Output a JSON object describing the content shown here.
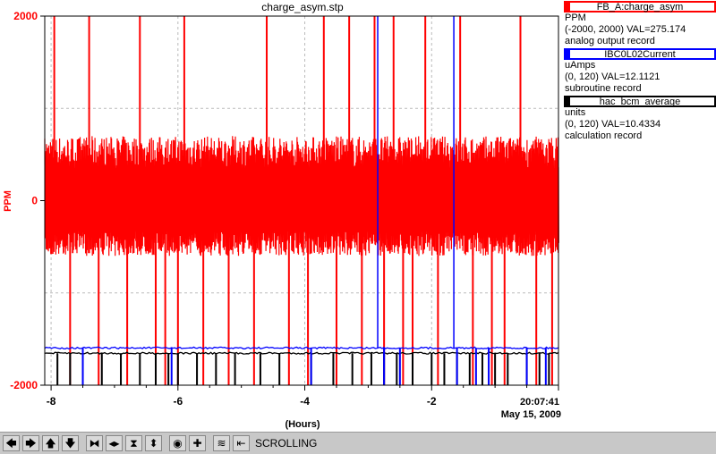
{
  "chart_data": {
    "type": "line",
    "title": "charge_asym.stp",
    "xlabel": "(Hours)",
    "ylabel": "PPM",
    "xlim": [
      -8.1,
      0
    ],
    "ylim": [
      -2000,
      2000
    ],
    "x_ticks": [
      -8,
      -6,
      -4,
      -2
    ],
    "x_tick_labels": [
      "-8",
      "-6",
      "-4",
      "-2"
    ],
    "y_ticks": [
      -2000,
      0,
      2000
    ],
    "y_tick_labels": [
      "-2000",
      "0",
      "2000"
    ],
    "end_time": "20:07:41",
    "end_date": "May 15, 2009",
    "grid": true,
    "series": [
      {
        "name": "FB_A:charge_asym",
        "color": "#ff0000",
        "axis_range": [
          -2000,
          2000
        ],
        "description": "noise band approximately -600..+700 PPM with frequent full-scale spikes",
        "band": [
          -600,
          700
        ],
        "spikes_up_x": [
          -7.95,
          -7.4,
          -6.6,
          -5.9,
          -4.6,
          -3.7,
          -3.3,
          -2.9,
          -2.6,
          -2.1,
          -1.55,
          -0.6
        ],
        "spikes_down_x": [
          -7.7,
          -7.25,
          -6.8,
          -6.35,
          -6.2,
          -6.0,
          -5.6,
          -5.2,
          -4.8,
          -4.25,
          -3.95,
          -3.5,
          -3.1,
          -2.75,
          -2.45,
          -2.3,
          -1.9,
          -1.35,
          -1.05,
          -0.85,
          -0.35,
          -0.1
        ]
      },
      {
        "name": "IBC0L02Current",
        "color": "#0000ff",
        "axis_range": [
          0,
          120
        ],
        "level": 12.1,
        "dips_x": [
          -7.5,
          -6.1,
          -3.9,
          -2.75,
          -2.5,
          -1.6,
          -1.3,
          -1.1,
          -0.5,
          -0.2
        ],
        "spikes_up_x": [
          -2.85,
          -1.65
        ]
      },
      {
        "name": "hac_bcm_average",
        "color": "#000000",
        "axis_range": [
          0,
          120
        ],
        "level": 10.4,
        "dips_x": [
          -7.9,
          -7.7,
          -7.5,
          -7.2,
          -6.9,
          -6.6,
          -6.35,
          -6.15,
          -6.0,
          -5.7,
          -5.4,
          -5.1,
          -4.7,
          -4.4,
          -3.9,
          -3.55,
          -3.25,
          -2.95,
          -2.75,
          -2.55,
          -2.3,
          -2.0,
          -1.8,
          -1.6,
          -1.4,
          -1.2,
          -1.0,
          -0.8,
          -0.5,
          -0.3,
          -0.15
        ]
      }
    ]
  },
  "legend": [
    {
      "name": "FB_A:charge_asym",
      "color": "#ff0000",
      "units": "PPM",
      "range": "(-2000, 2000) VAL=275.174",
      "record": "analog output record"
    },
    {
      "name": "IBC0L02Current",
      "color": "#0000ff",
      "units": "uAmps",
      "range": "(0, 120) VAL=12.1121",
      "record": "subroutine record"
    },
    {
      "name": "hac_bcm_average",
      "color": "#000000",
      "units": "units",
      "range": "(0, 120) VAL=10.4334",
      "record": "calculation record"
    }
  ],
  "toolbar": {
    "buttons": [
      {
        "name": "pan-left-button",
        "icon": "arrow-left-icon",
        "glyph": "🡄"
      },
      {
        "name": "pan-right-button",
        "icon": "arrow-right-icon",
        "glyph": "🡆"
      },
      {
        "name": "pan-up-button",
        "icon": "arrow-up-icon",
        "glyph": "🡅"
      },
      {
        "name": "pan-down-button",
        "icon": "arrow-down-icon",
        "glyph": "🡇"
      },
      {
        "name": "zoom-in-x-button",
        "icon": "zoom-in-x-icon",
        "glyph": "⧓"
      },
      {
        "name": "zoom-out-x-button",
        "icon": "zoom-out-x-icon",
        "glyph": "◂▸"
      },
      {
        "name": "zoom-in-y-button",
        "icon": "zoom-in-y-icon",
        "glyph": "⧗"
      },
      {
        "name": "zoom-out-y-button",
        "icon": "zoom-out-y-icon",
        "glyph": "⬍"
      },
      {
        "name": "autoscale-button",
        "icon": "target-icon",
        "glyph": "◉"
      },
      {
        "name": "center-button",
        "icon": "crosshair-icon",
        "glyph": "✚"
      },
      {
        "name": "default-scale-button",
        "icon": "waveform-icon",
        "glyph": "≋"
      },
      {
        "name": "scroll-mode-button",
        "icon": "scroll-back-icon",
        "glyph": "⇤"
      }
    ],
    "mode": "SCROLLING"
  }
}
